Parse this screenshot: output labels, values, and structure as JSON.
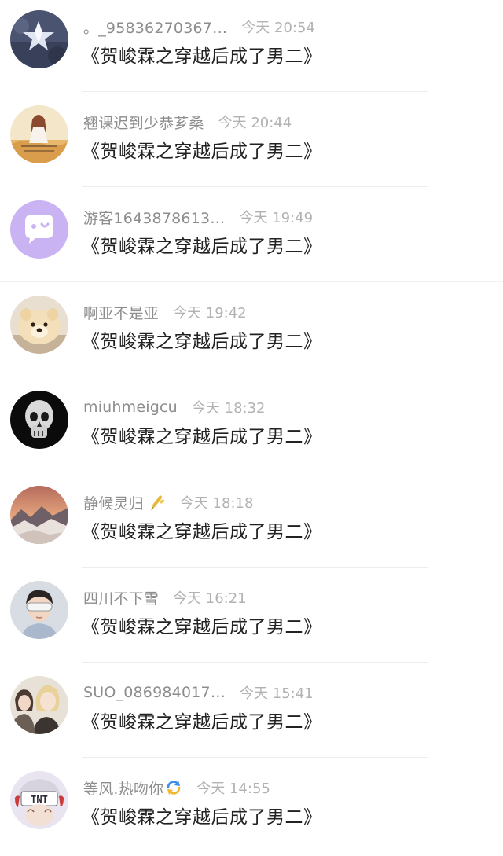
{
  "comments": [
    {
      "user": "。_95836270367…",
      "time": "今天 20:54",
      "text": "《贺峻霖之穿越后成了男二》",
      "avatar_icon": "paper-star-avatar-icon"
    },
    {
      "user": "翘课迟到少恭芗桑",
      "time": "今天 20:44",
      "text": "《贺峻霖之穿越后成了男二》",
      "avatar_icon": "girl-field-avatar-icon"
    },
    {
      "user": "游客1643878613…",
      "time": "今天 19:49",
      "text": "《贺峻霖之穿越后成了男二》",
      "avatar_icon": "chat-bubble-avatar-icon"
    },
    {
      "user": "啊亚不是亚",
      "time": "今天 19:42",
      "text": "《贺峻霖之穿越后成了男二》",
      "avatar_icon": "pomeranian-dog-avatar-icon"
    },
    {
      "user": "miuhmeigcu",
      "time": "今天 18:32",
      "text": "《贺峻霖之穿越后成了男二》",
      "avatar_icon": "skull-avatar-icon"
    },
    {
      "user": "静候灵归",
      "time": "今天 18:18",
      "text": "《贺峻霖之穿越后成了男二》",
      "avatar_icon": "mountain-sunset-avatar-icon",
      "badge_icon": "wheat-badge-icon"
    },
    {
      "user": "四川不下雪",
      "time": "今天 16:21",
      "text": "《贺峻霖之穿越后成了男二》",
      "avatar_icon": "boy-eye-mask-avatar-icon"
    },
    {
      "user": "SUO_086984017…",
      "time": "今天 15:41",
      "text": "《贺峻霖之穿越后成了男二》",
      "avatar_icon": "anime-couple-avatar-icon"
    },
    {
      "user": "等风.热吻你",
      "time": "今天 14:55",
      "text": "《贺峻霖之穿越后成了男二》",
      "avatar_icon": "tnt-cap-avatar-icon",
      "badge_icon": "refresh-badge-icon"
    }
  ],
  "colors": {
    "username": "#8d8d8d",
    "timestamp": "#b2b2b2",
    "message": "#222222",
    "divider": "#ededed"
  }
}
